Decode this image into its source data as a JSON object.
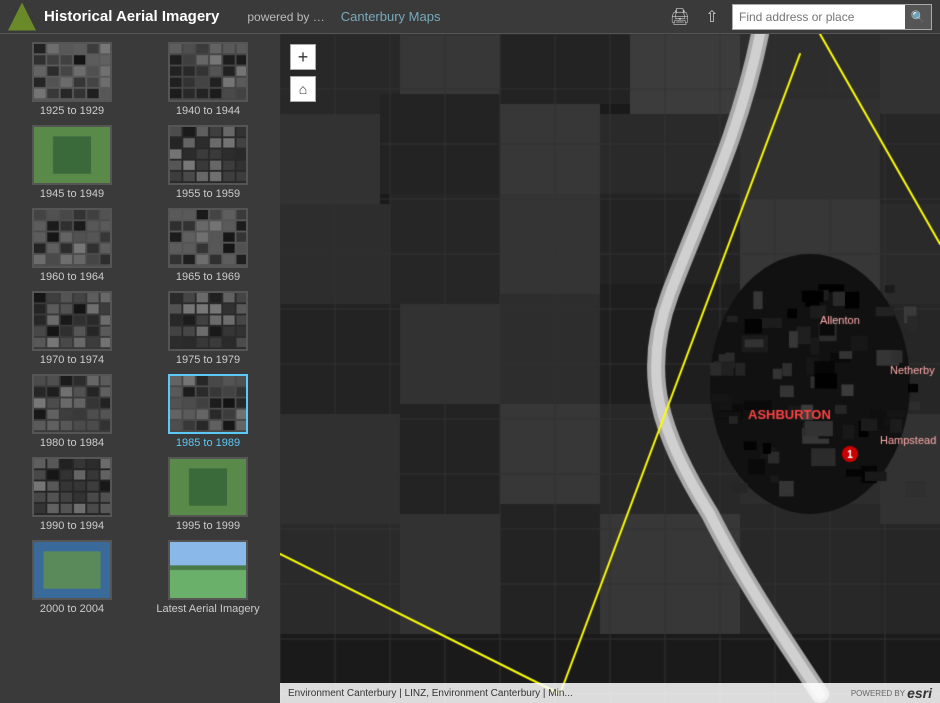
{
  "header": {
    "title": "Historical Aerial Imagery",
    "powered_by": "powered by …",
    "canterbury_maps": "Canterbury Maps",
    "search_placeholder": "Find address or place",
    "print_icon": "🖨",
    "share_icon": "🔗"
  },
  "sidebar": {
    "eras": [
      {
        "id": "1925-1929",
        "label": "1925 to 1929",
        "selected": false,
        "color_hint": "dark"
      },
      {
        "id": "1940-1944",
        "label": "1940 to 1944",
        "selected": false,
        "color_hint": "dark"
      },
      {
        "id": "1945-1949",
        "label": "1945 to 1949",
        "selected": false,
        "color_hint": "color"
      },
      {
        "id": "1955-1959",
        "label": "1955 to 1959",
        "selected": false,
        "color_hint": "dark"
      },
      {
        "id": "1960-1964",
        "label": "1960 to 1964",
        "selected": false,
        "color_hint": "dark"
      },
      {
        "id": "1965-1969",
        "label": "1965 to 1969",
        "selected": false,
        "color_hint": "dark"
      },
      {
        "id": "1970-1974",
        "label": "1970 to 1974",
        "selected": false,
        "color_hint": "dark"
      },
      {
        "id": "1975-1979",
        "label": "1975 to 1979",
        "selected": false,
        "color_hint": "dark"
      },
      {
        "id": "1980-1984",
        "label": "1980 to 1984",
        "selected": false,
        "color_hint": "dark"
      },
      {
        "id": "1985-1989",
        "label": "1985 to 1989",
        "selected": true,
        "color_hint": "dark"
      },
      {
        "id": "1990-1994",
        "label": "1990 to 1994",
        "selected": false,
        "color_hint": "dark"
      },
      {
        "id": "1995-1999",
        "label": "1995 to 1999",
        "selected": false,
        "color_hint": "color"
      },
      {
        "id": "2000-2004",
        "label": "2000 to 2004",
        "selected": false,
        "color_hint": "color"
      },
      {
        "id": "latest",
        "label": "Latest Aerial Imagery",
        "selected": false,
        "color_hint": "color"
      }
    ]
  },
  "map": {
    "attribution": "Environment Canterbury | LINZ, Environment Canterbury | Min...",
    "zoom_plus": "+",
    "home_symbol": "⌂",
    "place_labels": [
      {
        "name": "ASHBURTON",
        "color": "#ff4444"
      },
      {
        "name": "Allenton",
        "color": "#ff8888"
      },
      {
        "name": "Netherby",
        "color": "#ff8888"
      },
      {
        "name": "Hampstead",
        "color": "#ff8888"
      }
    ]
  },
  "esri": {
    "powered_text": "POWERED BY",
    "logo_text": "esri"
  }
}
